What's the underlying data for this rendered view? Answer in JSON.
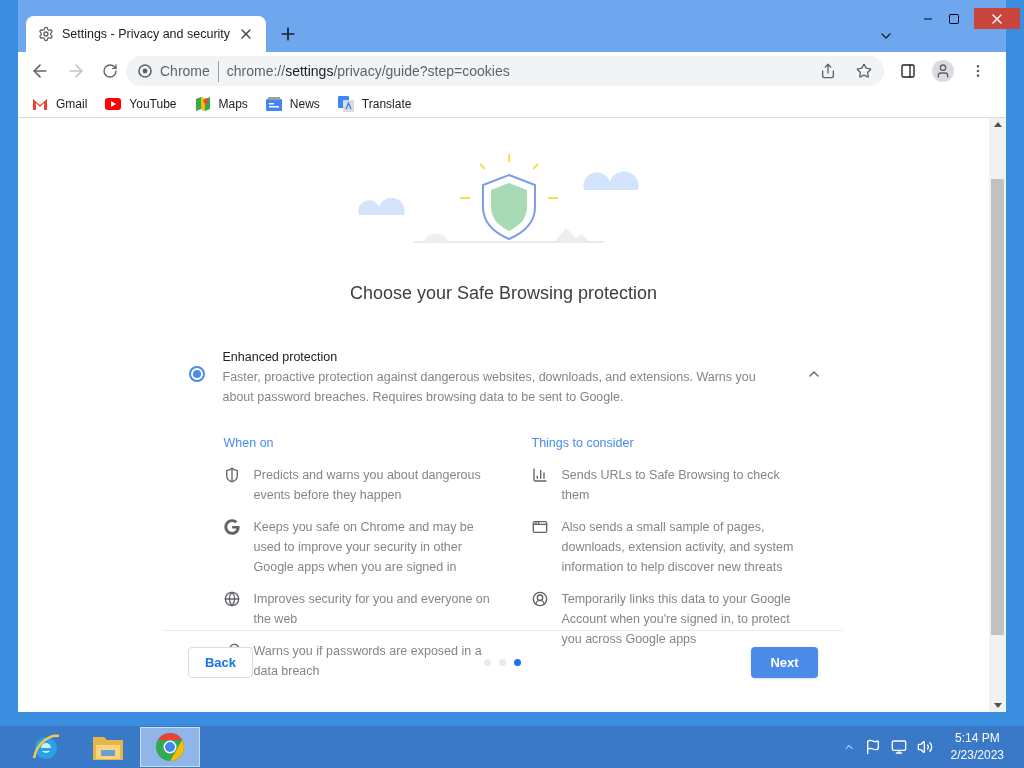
{
  "tab": {
    "title": "Settings - Privacy and security"
  },
  "address": {
    "chip": "Chrome",
    "url_prefix": "chrome://",
    "url_host": "settings",
    "url_path": "/privacy/guide?step=cookies"
  },
  "bookmarks": [
    {
      "kind": "gmail",
      "label": "Gmail"
    },
    {
      "kind": "youtube",
      "label": "YouTube"
    },
    {
      "kind": "maps",
      "label": "Maps"
    },
    {
      "kind": "news",
      "label": "News"
    },
    {
      "kind": "translate",
      "label": "Translate"
    }
  ],
  "page": {
    "heading": "Choose your Safe Browsing protection",
    "option": {
      "title": "Enhanced protection",
      "description": "Faster, proactive protection against dangerous websites, downloads, and extensions. Warns you about password breaches. Requires browsing data to be sent to Google.",
      "selected": true,
      "expanded": true
    },
    "columns": [
      {
        "heading": "When on",
        "items": [
          {
            "kind": "shield",
            "text": "Predicts and warns you about dangerous events before they happen"
          },
          {
            "kind": "google",
            "text": "Keeps you safe on Chrome and may be used to improve your security in other Google apps when you are signed in"
          },
          {
            "kind": "globe",
            "text": "Improves security for you and everyone on the web"
          },
          {
            "kind": "key",
            "text": "Warns you if passwords are exposed in a data breach"
          }
        ]
      },
      {
        "heading": "Things to consider",
        "items": [
          {
            "kind": "chart",
            "text": "Sends URLs to Safe Browsing to check them"
          },
          {
            "kind": "window",
            "text": "Also sends a small sample of pages, downloads, extension activity, and system information to help discover new threats"
          },
          {
            "kind": "account",
            "text": "Temporarily links this data to your Google Account when you're signed in, to protect you across Google apps"
          }
        ]
      }
    ],
    "footer": {
      "back": "Back",
      "next": "Next",
      "steps": [
        {
          "selected": false
        },
        {
          "selected": false
        },
        {
          "selected": true
        }
      ]
    }
  },
  "taskbar": {
    "apps": [
      {
        "kind": "ie",
        "selected": false
      },
      {
        "kind": "explorer",
        "selected": false
      },
      {
        "kind": "chrome",
        "selected": true
      }
    ],
    "time": "5:14 PM",
    "date": "2/23/2023"
  }
}
